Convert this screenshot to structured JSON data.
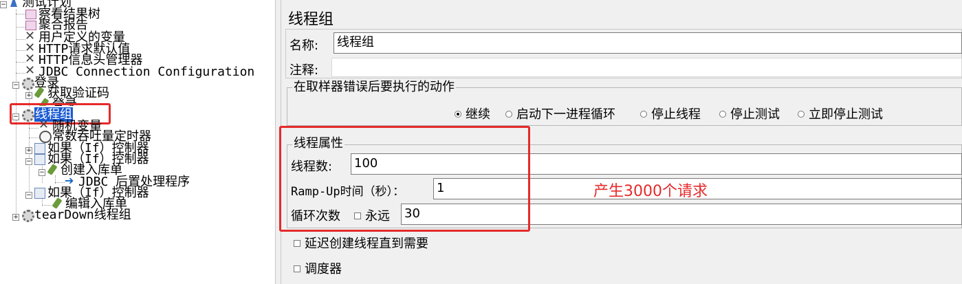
{
  "tree": {
    "root": "测试计划",
    "items": [
      {
        "label": "察看结果树"
      },
      {
        "label": "聚合报告"
      },
      {
        "label": "用户定义的变量"
      },
      {
        "label": "HTTP请求默认值"
      },
      {
        "label": "HTTP信息头管理器"
      },
      {
        "label": "JDBC Connection Configuration"
      },
      {
        "label": "登录"
      },
      {
        "label": "获取验证码"
      },
      {
        "label": "登录"
      },
      {
        "label": "线程组"
      },
      {
        "label": "随机变量"
      },
      {
        "label": "常数吞吐量定时器"
      },
      {
        "label": "如果（If）控制器"
      },
      {
        "label": "如果（If）控制器"
      },
      {
        "label": "创建入库单"
      },
      {
        "label": "JDBC 后置处理程序"
      },
      {
        "label": "如果（If）控制器"
      },
      {
        "label": "编辑入库单"
      },
      {
        "label": "tearDown线程组"
      }
    ]
  },
  "panel": {
    "title": "线程组",
    "name_label": "名称:",
    "name_value": "线程组",
    "comment_label": "注释:",
    "comment_value": "",
    "error_group_title": "在取样器错误后要执行的动作",
    "error_actions": [
      {
        "label": "继续",
        "selected": true
      },
      {
        "label": "启动下一进程循环",
        "selected": false
      },
      {
        "label": "停止线程",
        "selected": false
      },
      {
        "label": "停止测试",
        "selected": false
      },
      {
        "label": "立即停止测试",
        "selected": false
      }
    ],
    "thread_group_title": "线程属性",
    "threads_label": "线程数:",
    "threads_value": "100",
    "rampup_label": "Ramp-Up时间（秒）：",
    "rampup_value": "1",
    "loop_label": "循环次数",
    "forever_label": "永远",
    "loop_value": "30",
    "delay_label": "延迟创建线程直到需要",
    "scheduler_label": "调度器"
  },
  "annotation": {
    "text": "产生3000个请求",
    "color": "#e52a2a"
  }
}
